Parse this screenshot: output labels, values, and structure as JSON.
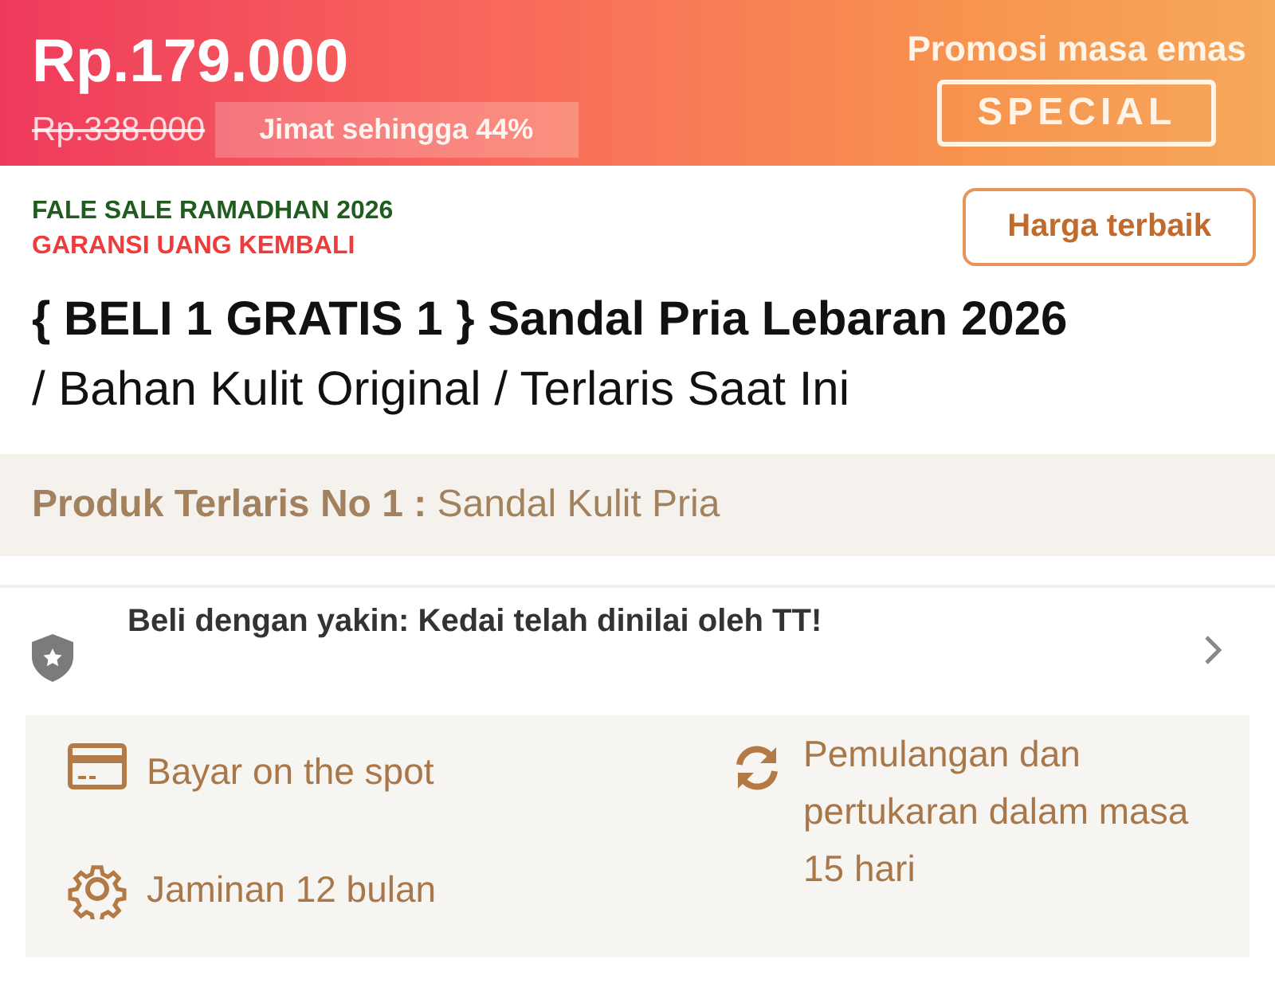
{
  "banner": {
    "price": "Rp.179.000",
    "original_price": "Rp.338.000",
    "discount": "Jimat sehingga 44%",
    "promo_label": "Promosi masa emas",
    "promo_badge": "SPECIAL"
  },
  "tags": [
    {
      "text": "FALE SALE RAMADHAN 2026",
      "color": "#1f5c1f"
    },
    {
      "text": "GARANSI UANG KEMBALI",
      "color": "#ee3b3b"
    }
  ],
  "best_price_button": "Harga terbaik",
  "title": {
    "bold": "{ BELI 1 GRATIS 1 } Sandal Pria Lebaran 2026",
    "rest": "/ Bahan Kulit Original / Terlaris Saat Ini"
  },
  "bestseller": {
    "label": "Produk Terlaris No 1 :",
    "value": "Sandal Kulit Pria"
  },
  "assurance": {
    "text": "Beli dengan yakin: Kedai telah dinilai oleh TT!"
  },
  "features": [
    {
      "kind": "card",
      "text": "Bayar on the spot"
    },
    {
      "kind": "gear",
      "text": "Jaminan 12 bulan"
    },
    {
      "kind": "refresh",
      "text": "Pemulangan dan pertukaran dalam masa 15 hari"
    }
  ]
}
